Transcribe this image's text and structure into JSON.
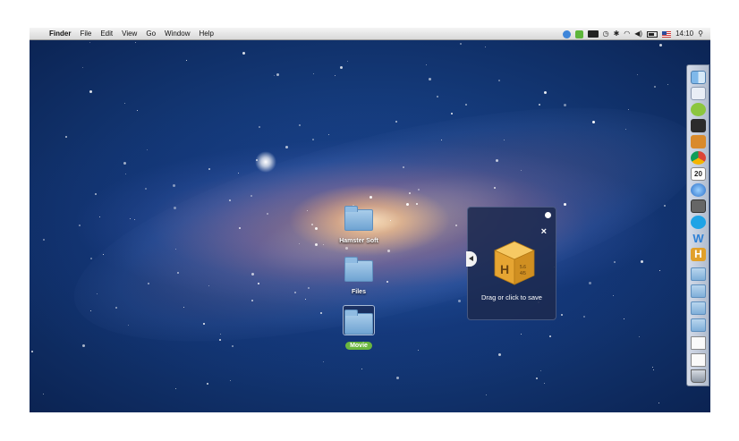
{
  "menubar": {
    "apple_glyph": "",
    "app_name": "Finder",
    "menus": [
      "File",
      "Edit",
      "View",
      "Go",
      "Window",
      "Help"
    ],
    "clock": "14:10",
    "status_icons": [
      "dropbox-icon",
      "shield-icon",
      "record-icon",
      "time-machine-icon",
      "bluetooth-icon",
      "wifi-icon",
      "volume-icon",
      "battery-icon",
      "us-flag-icon",
      "search-icon"
    ]
  },
  "desktop": {
    "items": [
      {
        "label": "Hamster Soft",
        "icon": "folder-icon"
      },
      {
        "label": "Files",
        "icon": "folder-icon"
      },
      {
        "label": "Movie",
        "icon": "folder-icon",
        "selected": true
      }
    ]
  },
  "drop_panel": {
    "box_label": "H",
    "box_version_top": "5.6",
    "box_version_bottom": "4/5",
    "caption": "Drag or click to save"
  },
  "dock": {
    "items": [
      "finder-icon",
      "preview-icon",
      "android-file-transfer-icon",
      "facetime-icon",
      "ibooks-icon",
      "chrome-icon",
      "calendar-icon",
      "itunes-icon",
      "photo-booth-icon",
      "skype-icon",
      "word-icon",
      "hamster-icon",
      "folder-icon",
      "folder-icon",
      "folder-icon",
      "folder-icon",
      "document-icon",
      "document-icon",
      "trash-icon"
    ],
    "calendar_day": "20",
    "hamster_letter": "H",
    "word_letter": "W"
  },
  "colors": {
    "selected_label_bg": "#6ab63e",
    "hamster_orange": "#e1a02a",
    "panel_bg": "#1c2a50"
  }
}
